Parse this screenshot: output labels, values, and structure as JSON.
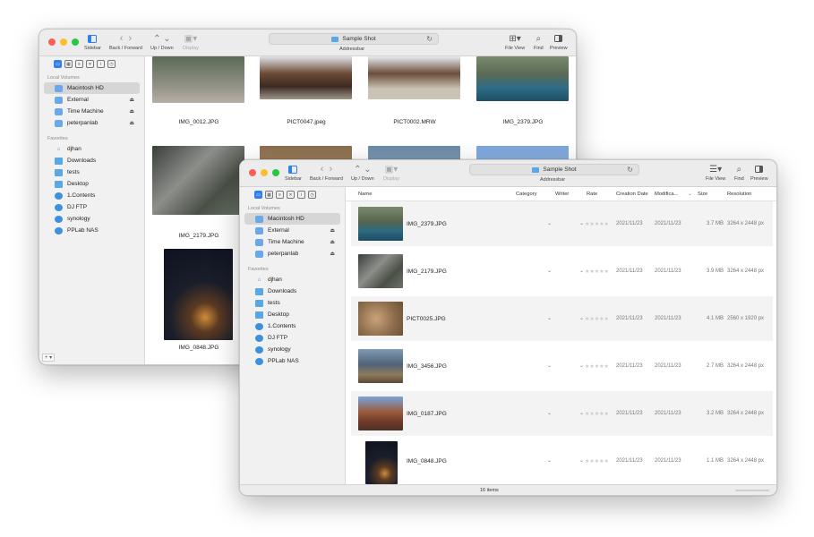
{
  "toolbar": {
    "sidebar": "Sidebar",
    "back_forward": "Back / Forward",
    "up_down": "Up / Down",
    "display": "Display",
    "title": "Sample Shot",
    "address_label": "Addressbar",
    "file_view": "File View",
    "find": "Find",
    "preview": "Preview"
  },
  "sidebar": {
    "local_heading": "Local Volumes",
    "favorites_heading": "Favorites",
    "local": [
      "Macintosh HD",
      "External",
      "Time Machine",
      "peterpanlab"
    ],
    "favorites": [
      "djhan",
      "Downloads",
      "tests",
      "Desktop",
      "1.Contents",
      "DJ FTP",
      "synology",
      "PPLab NAS"
    ],
    "bottom": "+ ▾"
  },
  "back_window": {
    "thumbs": [
      {
        "name": "IMG_0012.JPG"
      },
      {
        "name": "PICT0047.jpeg"
      },
      {
        "name": "PICT0002.MRW"
      },
      {
        "name": "IMG_2379.JPG"
      },
      {
        "name": "IMG_2179.JPG"
      },
      {
        "name": "IMG_0848.JPG"
      }
    ]
  },
  "front_window": {
    "columns": [
      "Name",
      "Category",
      "Writer",
      "Rate",
      "Creation Date",
      "Modifica...",
      "Size",
      "Resolution"
    ],
    "rows": [
      {
        "name": "IMG_2379.JPG",
        "created": "2021/11/23",
        "modified": "2021/11/23",
        "size": "3.7 MB",
        "resolution": "3264 x 2448 px"
      },
      {
        "name": "IMG_2179.JPG",
        "created": "2021/11/23",
        "modified": "2021/11/23",
        "size": "3.9 MB",
        "resolution": "3264 x 2448 px"
      },
      {
        "name": "PICT0025.JPG",
        "created": "2021/11/23",
        "modified": "2021/11/23",
        "size": "4.1 MB",
        "resolution": "2560 x 1920 px"
      },
      {
        "name": "IMG_3456.JPG",
        "created": "2021/11/23",
        "modified": "2021/11/23",
        "size": "2.7 MB",
        "resolution": "3264 x 2448 px"
      },
      {
        "name": "IMG_0187.JPG",
        "created": "2021/11/23",
        "modified": "2021/11/23",
        "size": "3.2 MB",
        "resolution": "3264 x 2448 px"
      },
      {
        "name": "IMG_0848.JPG",
        "created": "2021/11/23",
        "modified": "2021/11/23",
        "size": "1.1 MB",
        "resolution": "3264 x 2448 px"
      }
    ],
    "status": "16 items"
  }
}
